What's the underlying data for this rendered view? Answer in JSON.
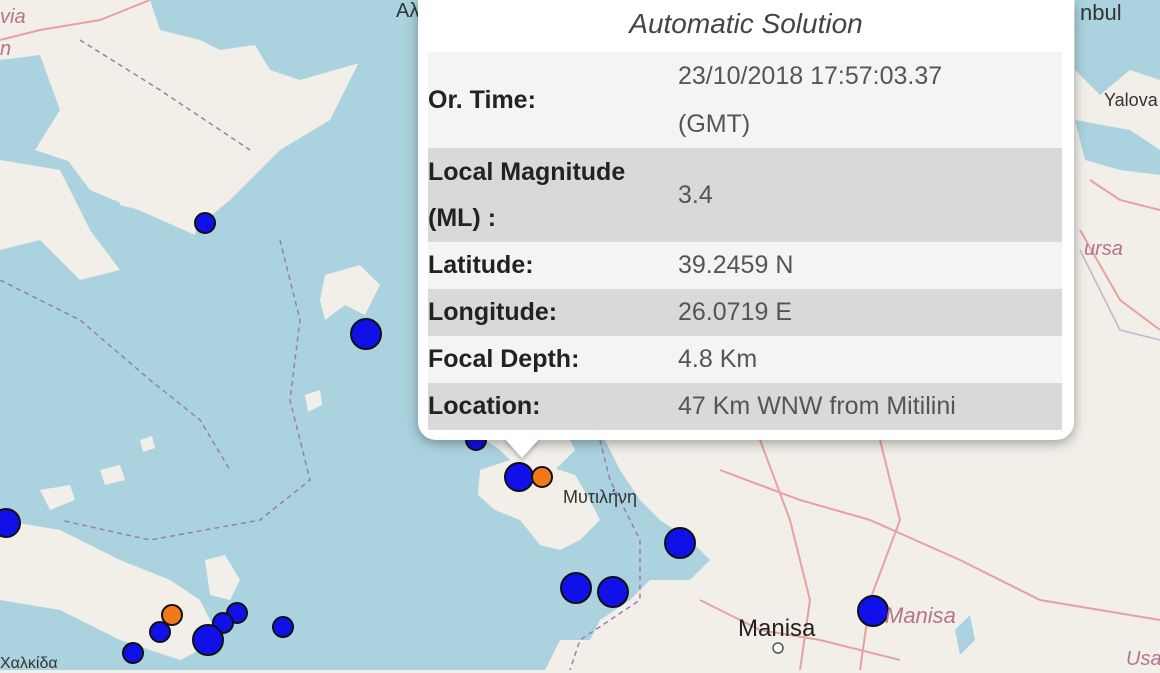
{
  "map": {
    "labels": {
      "top_left_italic_1": "via",
      "top_left_italic_2": "n",
      "top_greek_partial": "Αλ",
      "top_right": "nbul",
      "yalova": "Yalova",
      "bursa_partial": "ursa",
      "mytilini": "Μυτιλήνη",
      "manisa": "Manisa",
      "manisa_italic": "Manisa",
      "bottom_left": "Χαλκίδα",
      "bottom_right": "Usa"
    },
    "colors": {
      "sea": "#aad3df",
      "land": "#f2efe9",
      "quake_blue": "#1010e8",
      "quake_orange": "#f07a1a",
      "marker_outline": "#101010"
    }
  },
  "popup": {
    "title": "Automatic Solution",
    "rows": [
      {
        "key_line1": "Or. Time:",
        "key_line2": "",
        "value_line1": "23/10/2018 17:57:03.37",
        "value_line2": "(GMT)"
      },
      {
        "key_line1": "Local Magnitude",
        "key_line2": "(ML) :",
        "value_line1": "3.4",
        "value_line2": ""
      },
      {
        "key_line1": "Latitude:",
        "value_line1": "39.2459 N"
      },
      {
        "key_line1": "Longitude:",
        "value_line1": "26.0719 E"
      },
      {
        "key_line1": "Focal Depth:",
        "value_line1": "4.8 Km"
      },
      {
        "key_line1": "Location:",
        "value_line1": "47 Km WNW from Mitilini"
      }
    ]
  }
}
